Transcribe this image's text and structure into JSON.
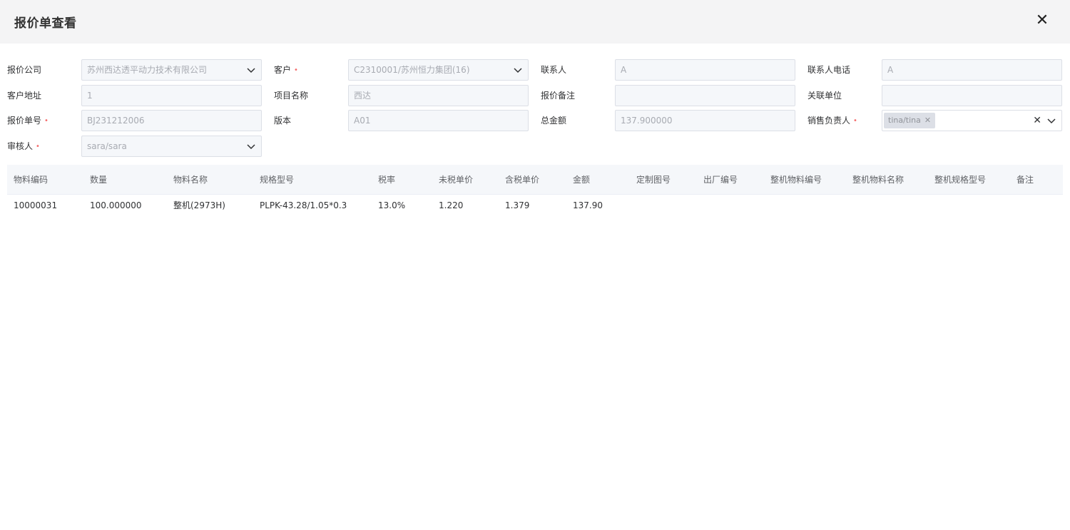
{
  "dialog": {
    "title": "报价单查看"
  },
  "form": {
    "company": {
      "label": "报价公司",
      "value": "苏州西达透平动力技术有限公司"
    },
    "customer": {
      "label": "客户",
      "value": "C2310001/苏州恒力集团(16)"
    },
    "contact": {
      "label": "联系人",
      "value": "A"
    },
    "contact_phone": {
      "label": "联系人电话",
      "value": "A"
    },
    "customer_address": {
      "label": "客户地址",
      "value": "1"
    },
    "project_name": {
      "label": "项目名称",
      "value": "西达"
    },
    "quote_remark": {
      "label": "报价备注",
      "value": ""
    },
    "related_unit": {
      "label": "关联单位",
      "value": ""
    },
    "quote_no": {
      "label": "报价单号",
      "value": "BJ231212006"
    },
    "version": {
      "label": "版本",
      "value": "A01"
    },
    "total_amount": {
      "label": "总金额",
      "value": "137.900000"
    },
    "sales_owner": {
      "label": "销售负责人",
      "tag": "tina/tina"
    },
    "reviewer": {
      "label": "审核人",
      "value": "sara/sara"
    }
  },
  "table": {
    "columns": [
      "物料编码",
      "数量",
      "物料名称",
      "规格型号",
      "税率",
      "未税单价",
      "含税单价",
      "金额",
      "定制图号",
      "出厂编号",
      "整机物料编号",
      "整机物料名称",
      "整机规格型号",
      "备注"
    ],
    "rows": [
      [
        "10000031",
        "100.000000",
        "整机(2973H)",
        "PLPK-43.28/1.05*0.3",
        "13.0%",
        "1.220",
        "1.379",
        "137.90",
        "",
        "",
        "",
        "",
        "",
        ""
      ]
    ]
  }
}
